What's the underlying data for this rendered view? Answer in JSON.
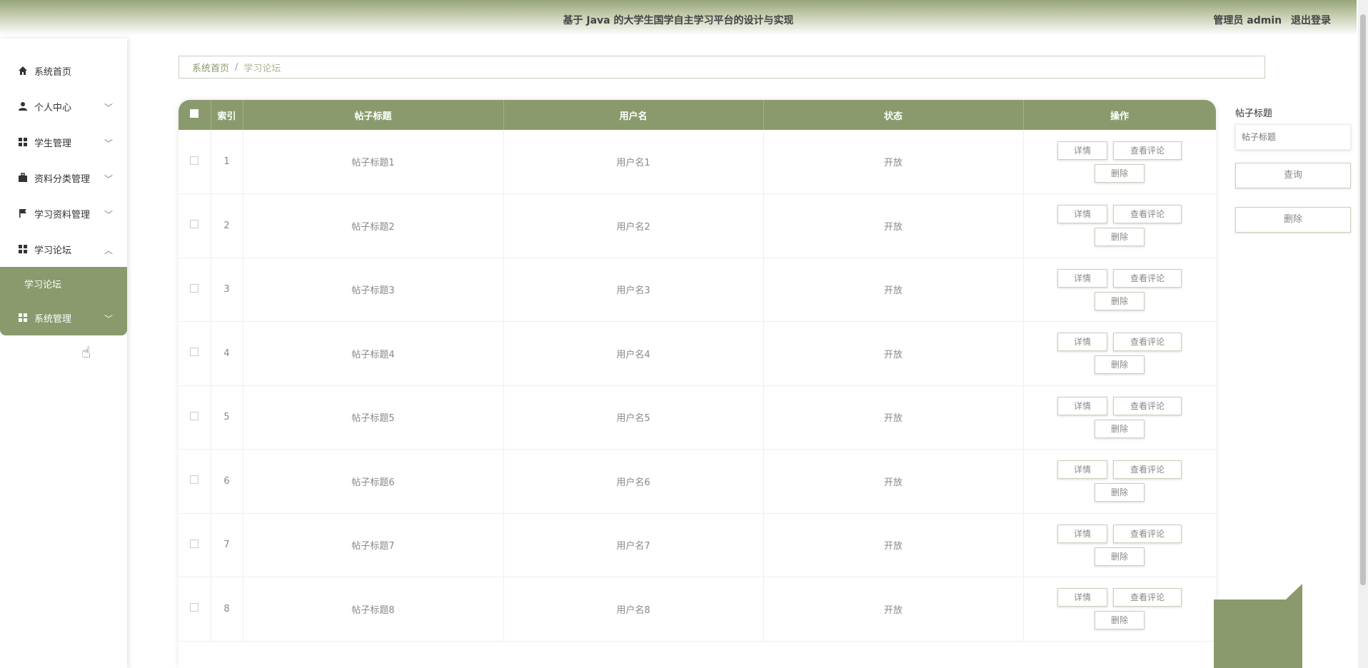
{
  "header": {
    "title": "基于 Java 的大学生国学自主学习平台的设计与实现",
    "user_label": "管理员 admin",
    "logout_label": "退出登录"
  },
  "sidebar": {
    "items": [
      {
        "label": "系统首页",
        "icon": "home-icon"
      },
      {
        "label": "个人中心",
        "icon": "user-icon"
      },
      {
        "label": "学生管理",
        "icon": "grid-icon"
      },
      {
        "label": "资料分类管理",
        "icon": "briefcase-icon"
      },
      {
        "label": "学习资料管理",
        "icon": "flag-icon"
      },
      {
        "label": "学习论坛",
        "icon": "grid-icon"
      },
      {
        "label": "系统管理",
        "icon": "grid-icon"
      }
    ],
    "submenu_item": "学习论坛"
  },
  "breadcrumb": {
    "home": "系统首页",
    "separator": "/",
    "current": "学习论坛"
  },
  "table": {
    "headers": [
      "索引",
      "帖子标题",
      "用户名",
      "状态",
      "操作"
    ],
    "rows": [
      {
        "index": "1",
        "title": "帖子标题1",
        "user": "用户名1",
        "status": "开放"
      },
      {
        "index": "2",
        "title": "帖子标题2",
        "user": "用户名2",
        "status": "开放"
      },
      {
        "index": "3",
        "title": "帖子标题3",
        "user": "用户名3",
        "status": "开放"
      },
      {
        "index": "4",
        "title": "帖子标题4",
        "user": "用户名4",
        "status": "开放"
      },
      {
        "index": "5",
        "title": "帖子标题5",
        "user": "用户名5",
        "status": "开放"
      },
      {
        "index": "6",
        "title": "帖子标题6",
        "user": "用户名6",
        "status": "开放"
      },
      {
        "index": "7",
        "title": "帖子标题7",
        "user": "用户名7",
        "status": "开放"
      },
      {
        "index": "8",
        "title": "帖子标题8",
        "user": "用户名8",
        "status": "开放"
      }
    ],
    "actions": {
      "detail": "详情",
      "view_comments": "查看评论",
      "delete": "删除"
    }
  },
  "search": {
    "label": "帖子标题",
    "placeholder": "帖子标题",
    "query_button": "查询",
    "delete_button": "删除"
  },
  "colors": {
    "accent": "#8a9a6c"
  }
}
